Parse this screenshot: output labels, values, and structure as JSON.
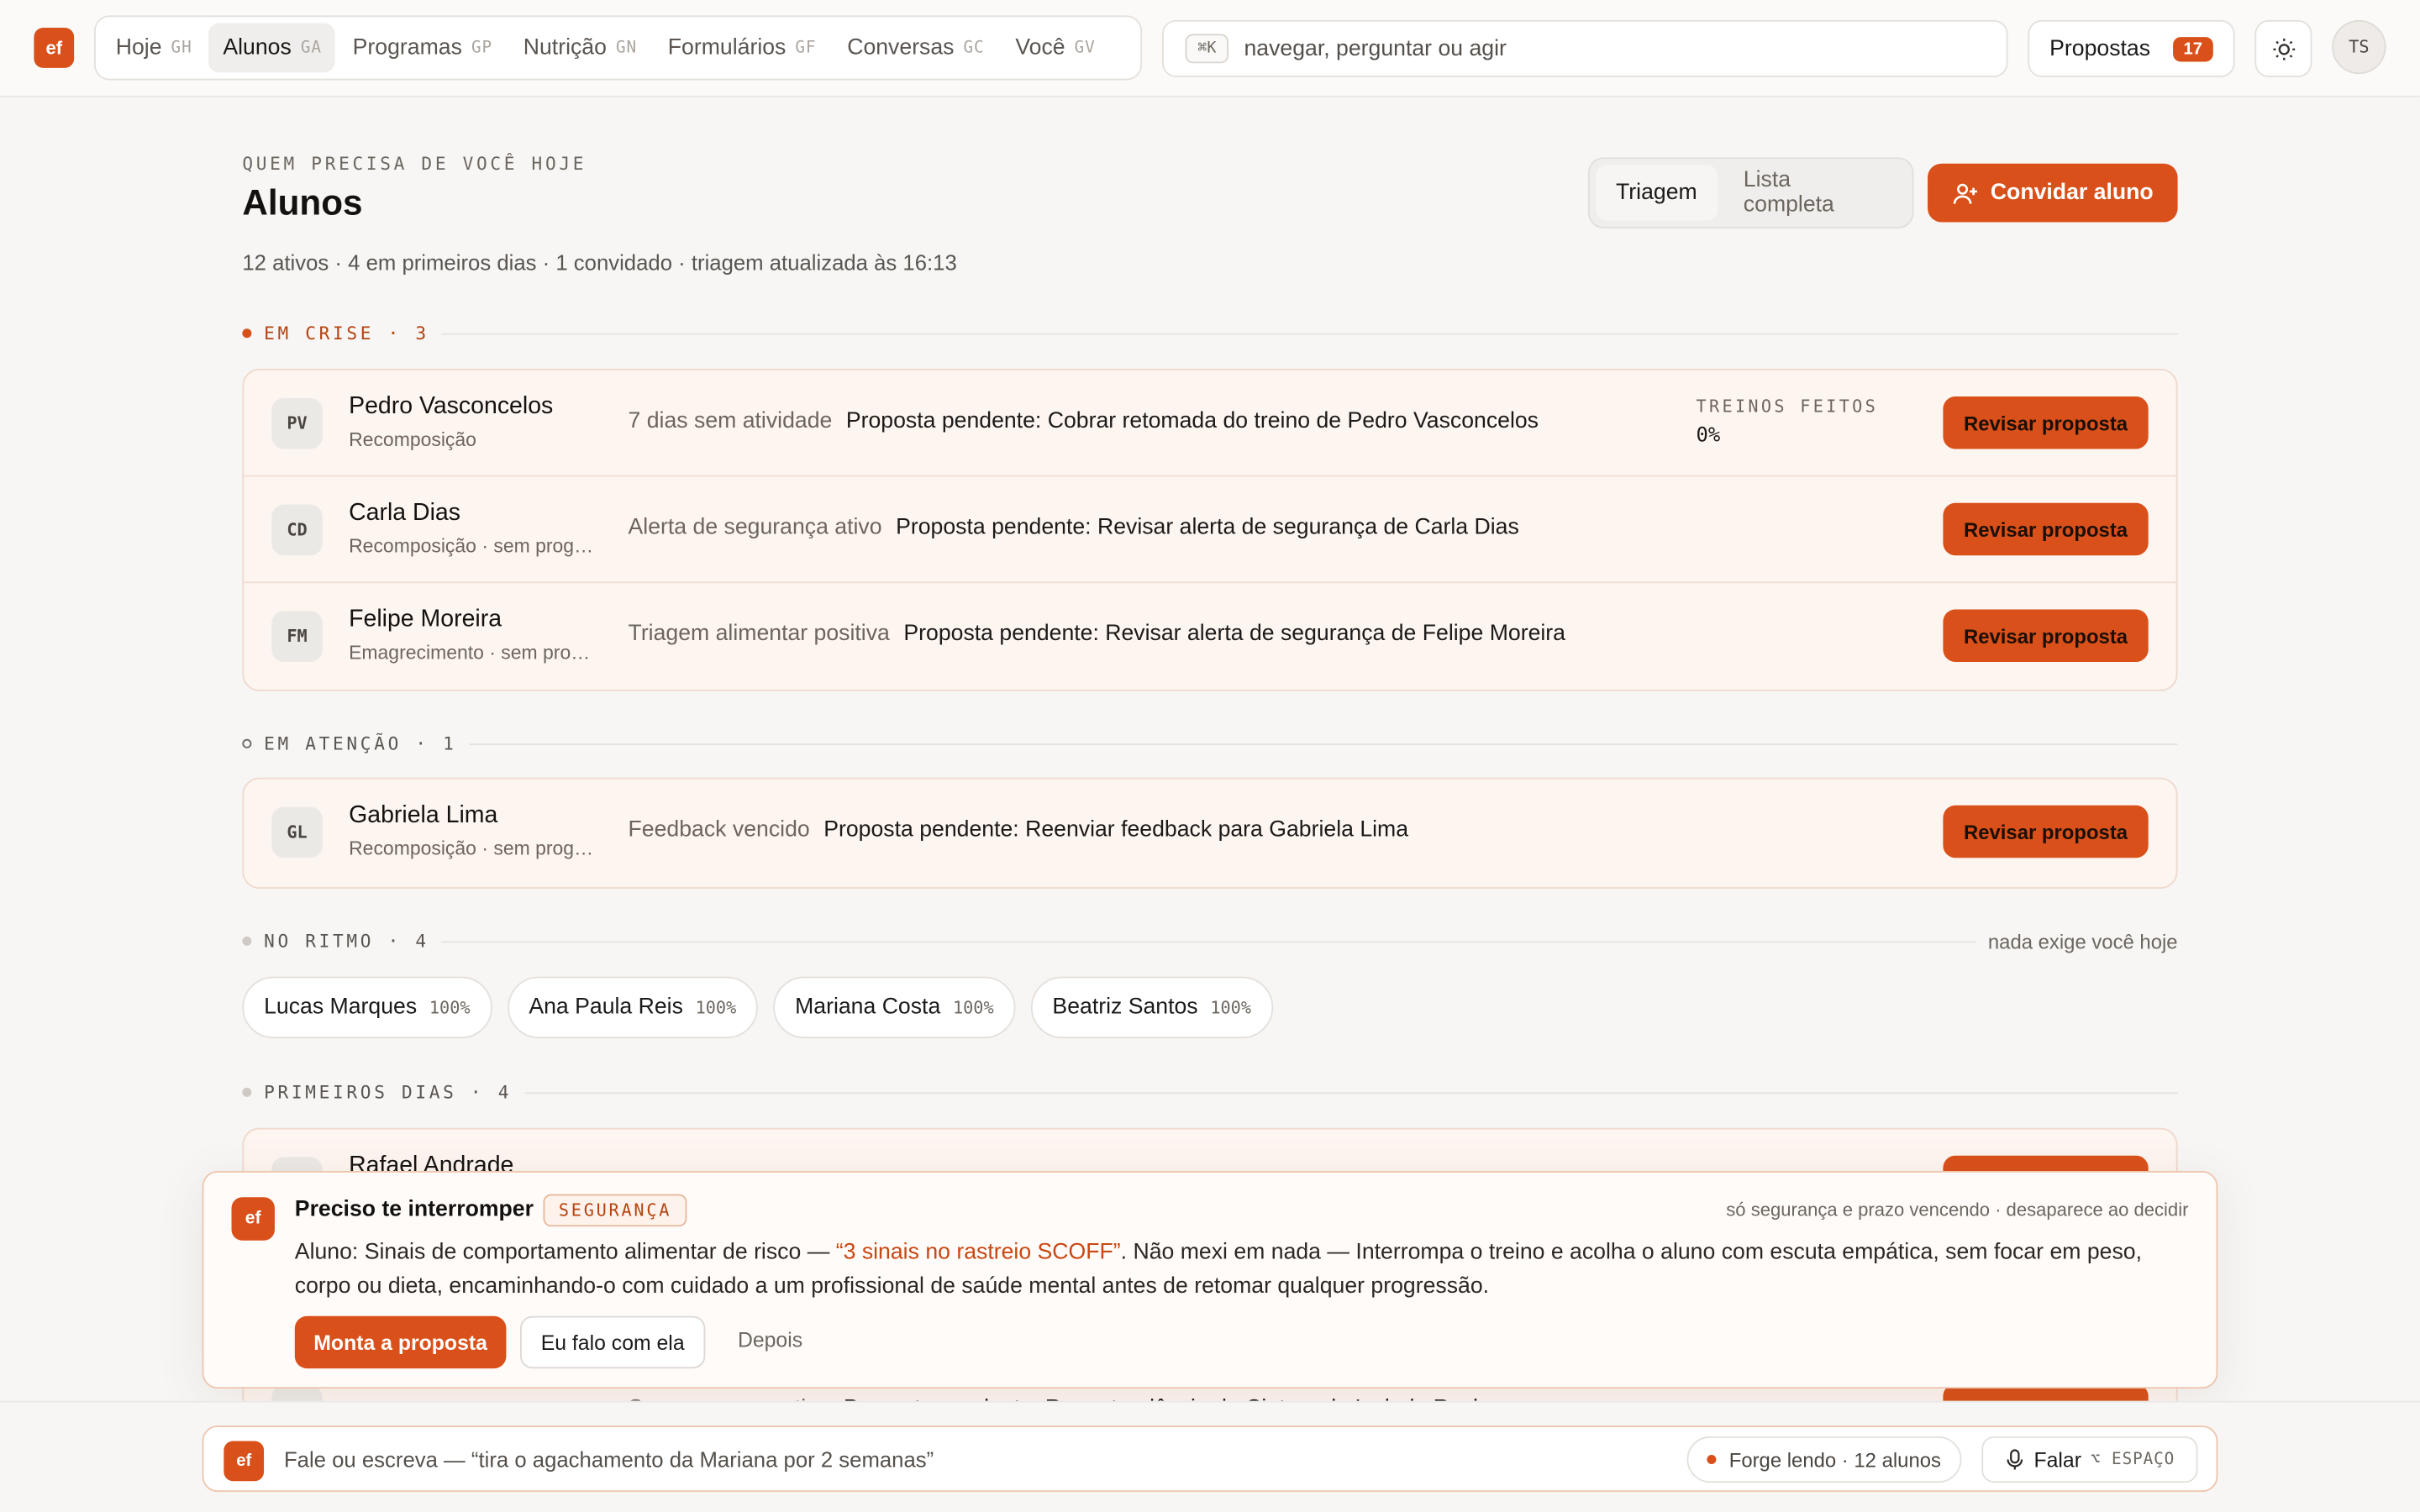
{
  "app": {
    "logo": "ef"
  },
  "nav": [
    {
      "label": "Hoje",
      "kbd": "GH",
      "active": false
    },
    {
      "label": "Alunos",
      "kbd": "GA",
      "active": true
    },
    {
      "label": "Programas",
      "kbd": "GP",
      "active": false
    },
    {
      "label": "Nutrição",
      "kbd": "GN",
      "active": false
    },
    {
      "label": "Formulários",
      "kbd": "GF",
      "active": false
    },
    {
      "label": "Conversas",
      "kbd": "GC",
      "active": false
    },
    {
      "label": "Você",
      "kbd": "GV",
      "active": false
    }
  ],
  "search": {
    "kbd": "⌘K",
    "placeholder": "navegar, perguntar ou agir"
  },
  "proposals": {
    "label": "Propostas",
    "count": "17"
  },
  "user": {
    "initials": "TS"
  },
  "header": {
    "eyebrow": "QUEM PRECISA DE VOCÊ HOJE",
    "title": "Alunos",
    "subtitle": "12 ativos · 4 em primeiros dias · 1 convidado · triagem atualizada às 16:13",
    "view_triage": "Triagem",
    "view_full": "Lista completa",
    "invite": "Convidar aluno"
  },
  "sections": {
    "crisis": {
      "label": "EM CRISE · 3",
      "rows": [
        {
          "initials": "PV",
          "name": "Pedro Vasconcelos",
          "meta": "Recomposição",
          "reason": "7 dias sem atividade",
          "pending": "Proposta pendente: Cobrar retomada do treino de Pedro Vasconcelos",
          "stat_label": "TREINOS FEITOS",
          "stat_value": "0%",
          "action": "Revisar proposta"
        },
        {
          "initials": "CD",
          "name": "Carla Dias",
          "meta": "Recomposição · sem programa",
          "reason": "Alerta de segurança ativo",
          "pending": "Proposta pendente: Revisar alerta de segurança de Carla Dias",
          "action": "Revisar proposta"
        },
        {
          "initials": "FM",
          "name": "Felipe Moreira",
          "meta": "Emagrecimento · sem programa",
          "reason": "Triagem alimentar positiva",
          "pending": "Proposta pendente: Revisar alerta de segurança de Felipe Moreira",
          "action": "Revisar proposta"
        }
      ]
    },
    "attention": {
      "label": "EM ATENÇÃO · 1",
      "rows": [
        {
          "initials": "GL",
          "name": "Gabriela Lima",
          "meta": "Recomposição · sem programa",
          "reason": "Feedback vencido",
          "pending": "Proposta pendente: Reenviar feedback para Gabriela Lima",
          "action": "Revisar proposta"
        }
      ]
    },
    "on_track": {
      "label": "NO RITMO · 4",
      "note": "nada exige você hoje",
      "chips": [
        {
          "name": "Lucas Marques",
          "pct": "100%"
        },
        {
          "name": "Ana Paula Reis",
          "pct": "100%"
        },
        {
          "name": "Mariana Costa",
          "pct": "100%"
        },
        {
          "name": "Beatriz Santos",
          "pct": "100%"
        }
      ]
    },
    "first_days": {
      "label": "PRIMEIROS DIAS · 4",
      "rows": [
        {
          "initials": "RA",
          "name": "Rafael Andrade",
          "action": "Revisar proposta"
        },
        {
          "initials": "IR",
          "reason": "Sem programa ativo",
          "pending": "Proposta pendente: Rever tendência de Cintura de Isabela Rocha",
          "action": "Revisar proposta"
        }
      ]
    }
  },
  "interrupt": {
    "logo": "ef",
    "title": "Preciso te interromper",
    "tag": "SEGURANÇA",
    "note": "só segurança e prazo vencendo · desaparece ao decidir",
    "body_prefix": "Aluno: Sinais de comportamento alimentar de risco — ",
    "body_highlight": "“3 sinais no rastreio SCOFF”",
    "body_suffix": ". Não mexi em nada — Interrompa o treino e acolha o aluno com escuta empática, sem focar em peso, corpo ou dieta, encaminhando-o com cuidado a um profissional de saúde mental antes de retomar qualquer progressão.",
    "primary": "Monta a proposta",
    "secondary": "Eu falo com ela",
    "ghost": "Depois"
  },
  "composer": {
    "logo": "ef",
    "placeholder": "Fale ou escreva — “tira o agachamento da Mariana por 2 semanas”",
    "status": "Forge lendo · 12 alunos",
    "speak": "Falar",
    "speak_kbd": "⌥ ESPAÇO"
  },
  "colors": {
    "accent": "#d9501a",
    "crisis_bg": "#fdf5f0",
    "page_bg": "#f7f6f5"
  }
}
